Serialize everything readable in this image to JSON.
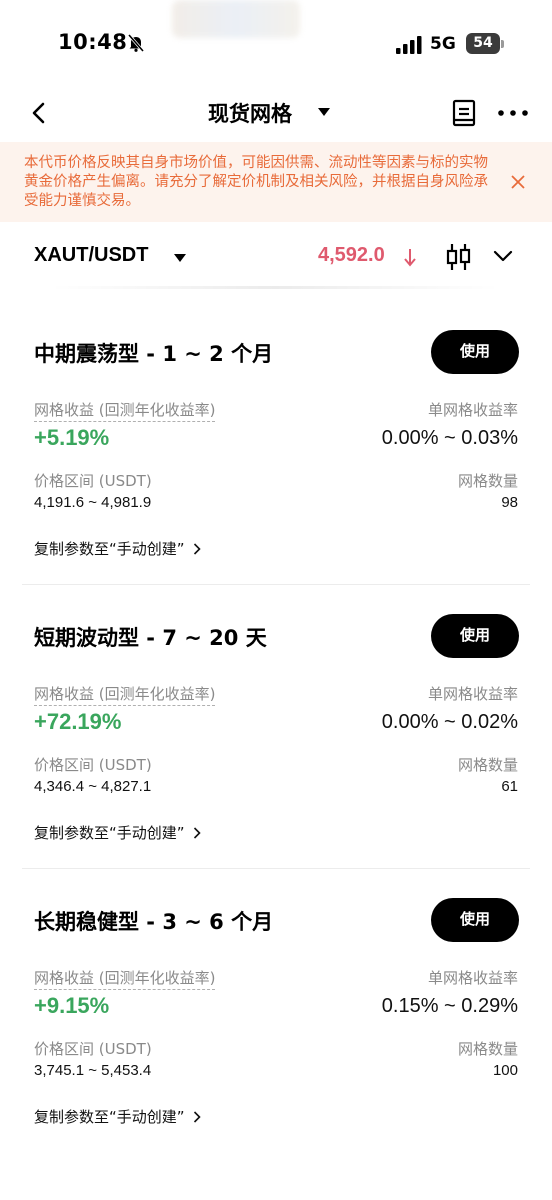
{
  "status_bar": {
    "time": "10:48",
    "network": "5G",
    "battery": "54"
  },
  "nav": {
    "title": "现货网格"
  },
  "banner": {
    "text": "本代币价格反映其自身市场价值，可能因供需、流动性等因素与标的实物黄金价格产生偏离。请充分了解定价机制及相关风险，并根据自身风险承受能力谨慎交易。"
  },
  "pair": {
    "symbol": "XAUT/USDT",
    "price": "4,592.0"
  },
  "labels": {
    "grid_yield": "网格收益 (回测年化收益率)",
    "single_grid_rate": "单网格收益率",
    "price_range": "价格区间 (USDT)",
    "grid_count": "网格数量",
    "use": "使用",
    "copy": "复制参数至“手动创建”"
  },
  "cards": [
    {
      "title": "中期震荡型 - 1 ~ 2 个月",
      "yield": "+5.19%",
      "rate": "0.00% ~ 0.03%",
      "range": "4,191.6 ~ 4,981.9",
      "count": "98"
    },
    {
      "title": "短期波动型 - 7 ~ 20 天",
      "yield": "+72.19%",
      "rate": "0.00% ~ 0.02%",
      "range": "4,346.4 ~ 4,827.1",
      "count": "61"
    },
    {
      "title": "长期稳健型 - 3 ~ 6 个月",
      "yield": "+9.15%",
      "rate": "0.15% ~ 0.29%",
      "range": "3,745.1 ~ 5,453.4",
      "count": "100"
    }
  ],
  "colors": {
    "accent_up": "#3aa65d",
    "price_down": "#df5a6e",
    "banner_text": "#e86b3a",
    "banner_bg": "#fdf3ed"
  }
}
